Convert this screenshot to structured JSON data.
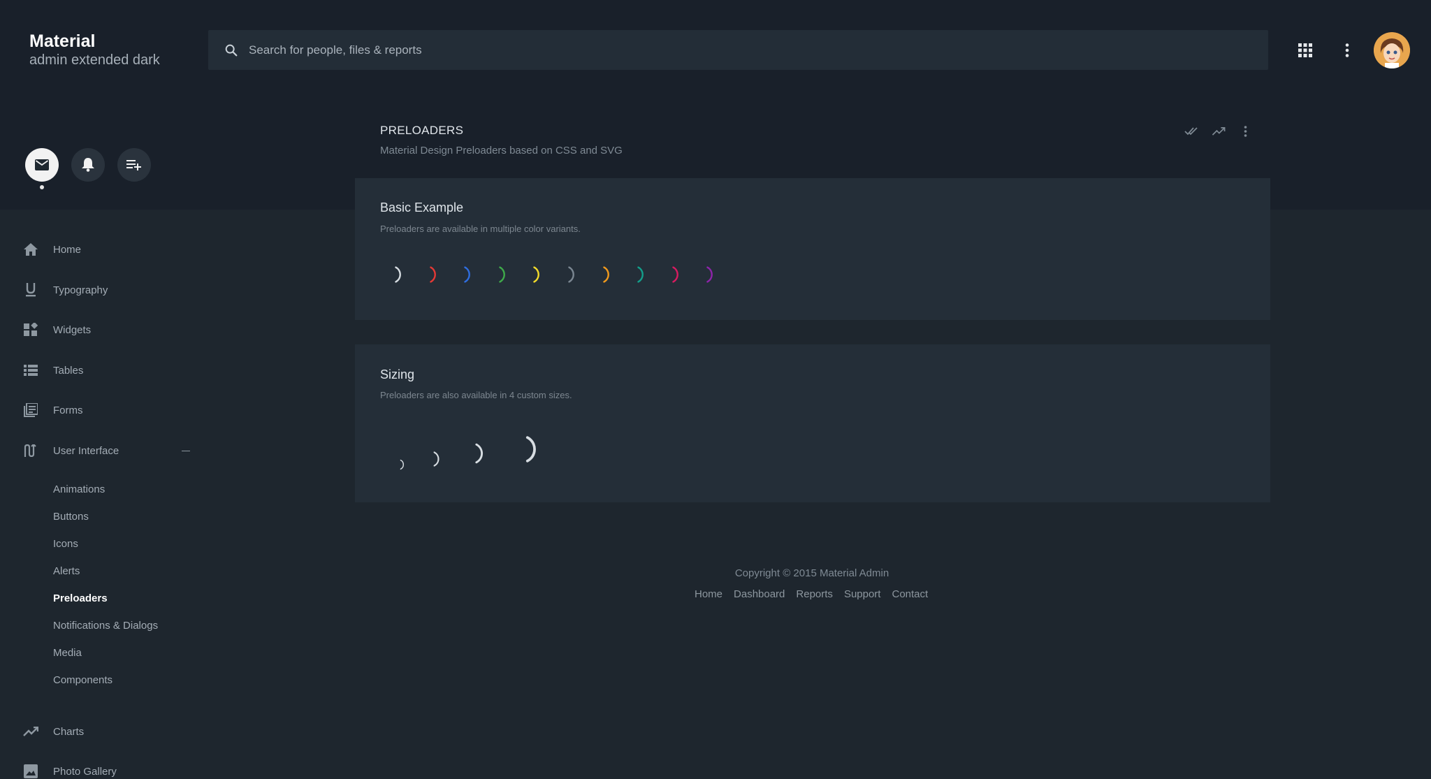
{
  "brand": {
    "title": "Material",
    "subtitle": "admin extended dark"
  },
  "search": {
    "placeholder": "Search for people, files & reports"
  },
  "header": {
    "icons": [
      "apps-icon",
      "more-vert-icon"
    ],
    "avatar": "user-avatar"
  },
  "profile_actions": [
    {
      "icon": "mail-icon",
      "active": true
    },
    {
      "icon": "bell-icon",
      "active": false
    },
    {
      "icon": "playlist-add-icon",
      "active": false
    }
  ],
  "sidebar": {
    "items": [
      {
        "label": "Home",
        "icon": "home-icon"
      },
      {
        "label": "Typography",
        "icon": "format-underline-icon"
      },
      {
        "label": "Widgets",
        "icon": "widgets-icon"
      },
      {
        "label": "Tables",
        "icon": "list-icon"
      },
      {
        "label": "Forms",
        "icon": "library-books-icon"
      },
      {
        "label": "User Interface",
        "icon": "swap-icon",
        "expanded": true
      },
      {
        "label": "Charts",
        "icon": "trending-up-icon"
      },
      {
        "label": "Photo Gallery",
        "icon": "image-icon"
      }
    ],
    "sub_items": [
      {
        "label": "Animations"
      },
      {
        "label": "Buttons"
      },
      {
        "label": "Icons"
      },
      {
        "label": "Alerts"
      },
      {
        "label": "Preloaders",
        "active": true
      },
      {
        "label": "Notifications & Dialogs"
      },
      {
        "label": "Media"
      },
      {
        "label": "Components"
      }
    ]
  },
  "page": {
    "title": "PRELOADERS",
    "subtitle": "Material Design Preloaders based on CSS and SVG",
    "actions": [
      "done-all-icon",
      "trending-up-icon",
      "more-vert-icon"
    ]
  },
  "cards": {
    "basic": {
      "title": "Basic Example",
      "subtitle": "Preloaders are available in multiple color variants.",
      "colors": [
        "#d7dde2",
        "#e53935",
        "#2f6ee0",
        "#3faa4a",
        "#f4dc2a",
        "#7b8792",
        "#f29a1c",
        "#139f8b",
        "#d81b60",
        "#8e24aa"
      ]
    },
    "sizing": {
      "title": "Sizing",
      "subtitle": "Preloaders are also available in 4 custom sizes.",
      "color": "#d7dde2"
    }
  },
  "footer": {
    "copyright": "Copyright © 2015 Material Admin",
    "links": [
      "Home",
      "Dashboard",
      "Reports",
      "Support",
      "Contact"
    ]
  },
  "colors": {
    "background": "#1e262e",
    "top_band": "#19202a",
    "card": "#242e38",
    "search": "#232d37"
  }
}
